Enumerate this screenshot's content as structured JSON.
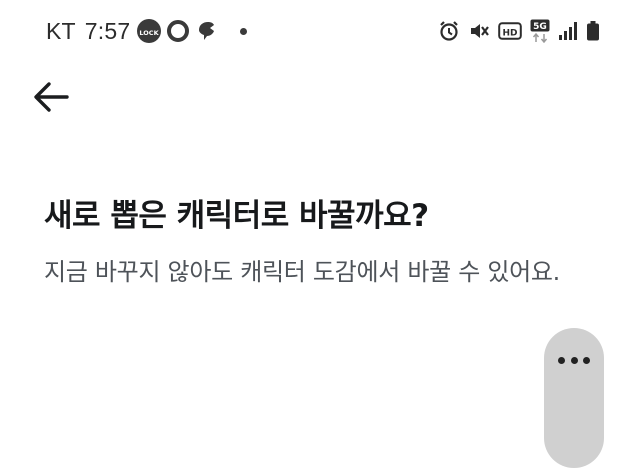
{
  "status_bar": {
    "carrier": "KT",
    "time": "7:57",
    "lock_badge_text": "LOCK",
    "network_badge": "5G",
    "hd_badge": "HD"
  },
  "nav": {
    "back_icon": "arrow-left-icon"
  },
  "content": {
    "title": "새로 뽑은 캐릭터로 바꿀까요?",
    "description": "지금 바꾸지 않아도 캐릭터 도감에서 바꿀 수 있어요."
  },
  "floating": {
    "icon": "more-horizontal-icon"
  },
  "colors": {
    "background": "#ffffff",
    "title": "#17191b",
    "description": "#4e5359",
    "handle": "#d0d0d0"
  }
}
